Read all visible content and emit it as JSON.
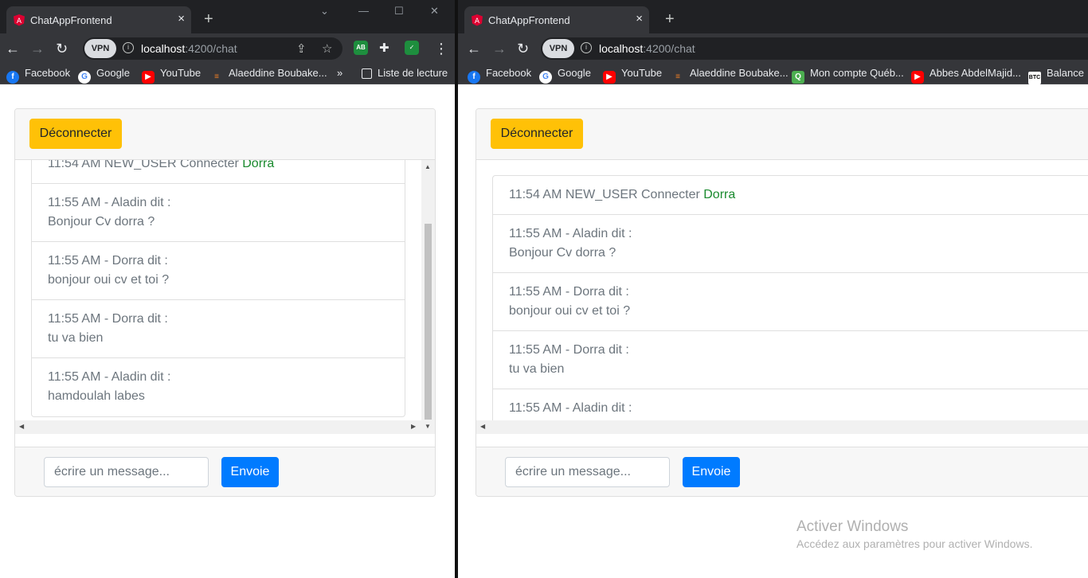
{
  "browser": {
    "tab_title": "ChatAppFrontend",
    "tab_close": "×",
    "new_tab": "+",
    "vpn_label": "VPN",
    "url_host": "localhost",
    "url_path": ":4200/chat",
    "more_bookmarks": "»",
    "reading_list": "Liste de lecture",
    "ext_ab": "AB"
  },
  "bookmarks_left": [
    {
      "label": "Facebook",
      "icon": "facebook-icon",
      "color": "#1877f2"
    },
    {
      "label": "Google",
      "icon": "google-icon",
      "color": "#ffffff"
    },
    {
      "label": "YouTube",
      "icon": "youtube-icon",
      "color": "#ff0000"
    },
    {
      "label": "Alaeddine Boubake...",
      "icon": "stackoverflow-icon",
      "color": "#f48024"
    }
  ],
  "bookmarks_right": [
    {
      "label": "Facebook",
      "icon": "facebook-icon",
      "color": "#1877f2"
    },
    {
      "label": "Google",
      "icon": "google-icon",
      "color": "#ffffff"
    },
    {
      "label": "YouTube",
      "icon": "youtube-icon",
      "color": "#ff0000"
    },
    {
      "label": "Alaeddine Boubake...",
      "icon": "stackoverflow-icon",
      "color": "#f48024"
    },
    {
      "label": "Mon compte Québ...",
      "icon": "quebec-icon",
      "color": "#4caf50"
    },
    {
      "label": "Abbes AbdelMajid...",
      "icon": "youtube-icon",
      "color": "#ff0000"
    },
    {
      "label": "Balance",
      "icon": "btc-icon",
      "color": "#ffffff"
    }
  ],
  "chat": {
    "logout_label": "Déconnecter",
    "input_placeholder": "écrire un message...",
    "send_label": "Envoie",
    "system_message": {
      "text": "11:54 AM NEW_USER Connecter ",
      "user": "Dorra"
    },
    "messages": [
      {
        "header": "11:55 AM - Aladin dit :",
        "body": "Bonjour Cv dorra ?"
      },
      {
        "header": "11:55 AM - Dorra dit :",
        "body": "bonjour oui cv et toi ?"
      },
      {
        "header": "11:55 AM - Dorra dit :",
        "body": "tu va bien"
      },
      {
        "header": "11:55 AM - Aladin dit :",
        "body": "hamdoulah labes"
      }
    ]
  },
  "windows_watermark": {
    "title": "Activer Windows",
    "subtitle": "Accédez aux paramètres pour activer Windows."
  },
  "colors": {
    "warning": "#ffc107",
    "primary": "#007bff",
    "user_green": "#1a8a2e"
  }
}
